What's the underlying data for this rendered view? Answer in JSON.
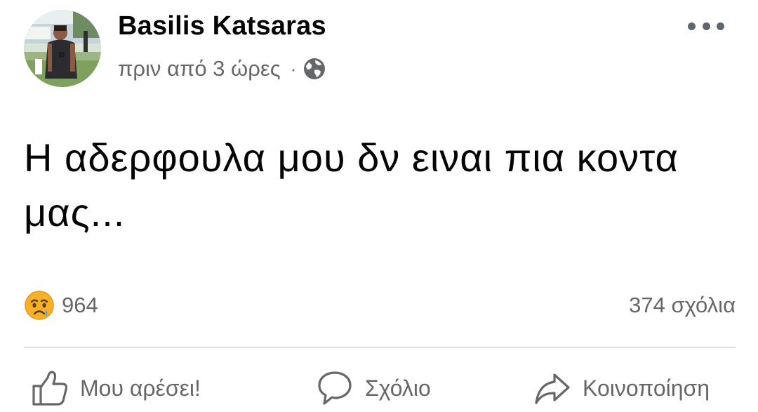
{
  "post": {
    "author": "Basilis Katsaras",
    "time": "πριν από 3 ώρες",
    "separator": "·",
    "privacy_icon": "globe-icon",
    "more_icon": "more-dots-icon",
    "text": "Η αδερφουλα μου δν ειναι πια κοντα μας..."
  },
  "stats": {
    "reaction_icon": "crying-face-icon",
    "reactions_count": "964",
    "comments": "374 σχόλια"
  },
  "actions": {
    "like_icon": "thumbs-up-icon",
    "like_label": "Μου αρέσει!",
    "comment_icon": "speech-bubble-icon",
    "comment_label": "Σχόλιο",
    "share_icon": "share-arrow-icon",
    "share_label": "Κοινοποίηση"
  },
  "colors": {
    "text_primary": "#050505",
    "text_secondary": "#65676b",
    "divider": "#dadde1",
    "reaction_yellow": "#f7b125"
  }
}
